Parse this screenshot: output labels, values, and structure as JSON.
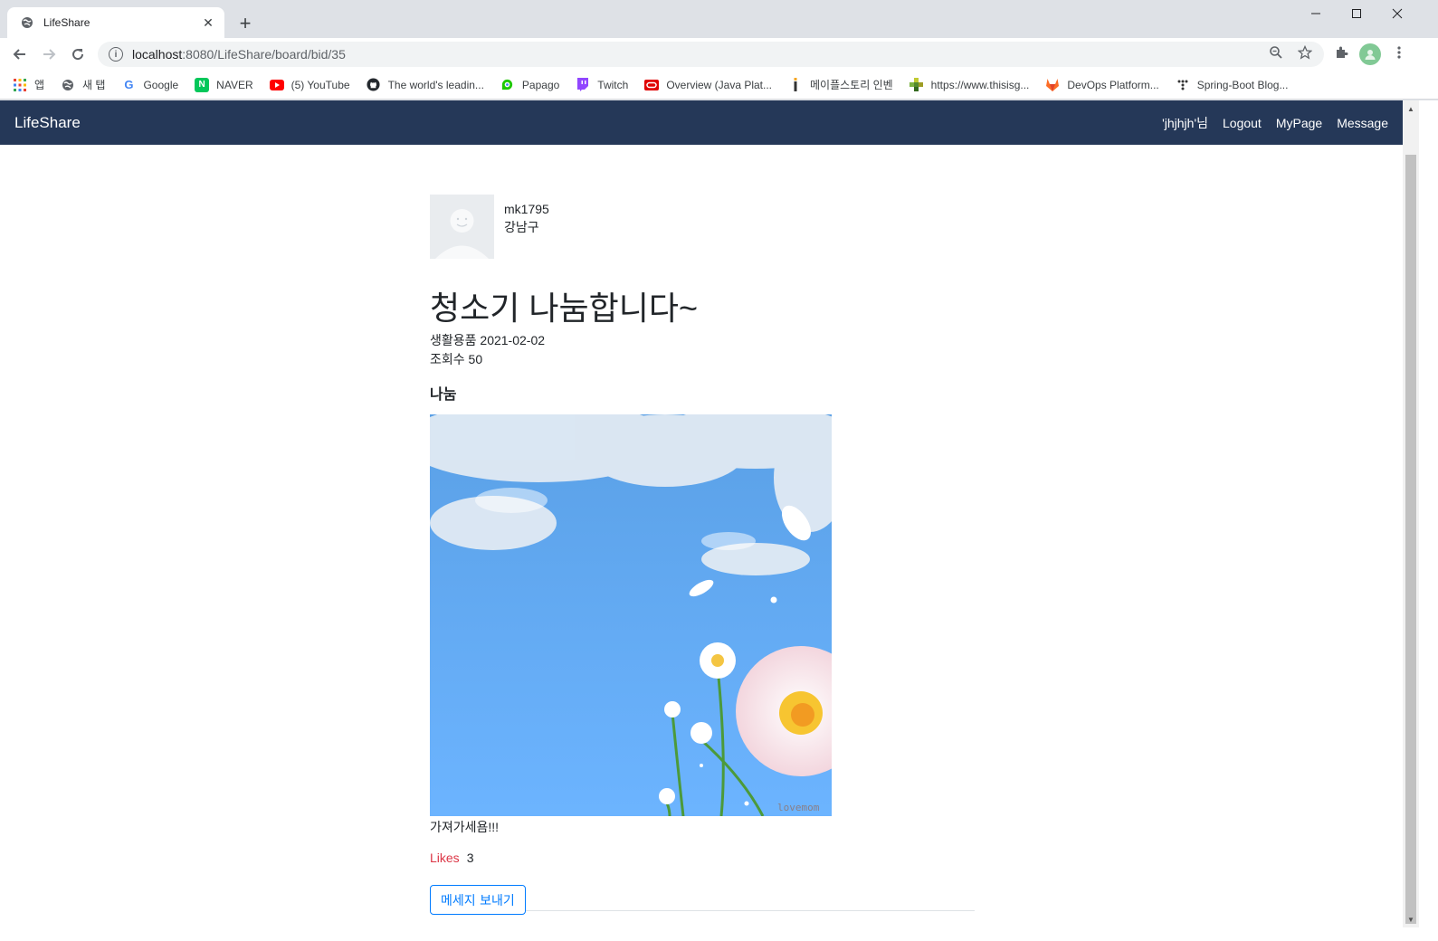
{
  "browser": {
    "tab_title": "LifeShare",
    "new_tab": "+",
    "url_host": "localhost",
    "url_path": ":8080/LifeShare/board/bid/35",
    "bookmarks": [
      {
        "label": "앱",
        "icon": "apps-grid-icon"
      },
      {
        "label": "새 탭",
        "icon": "globe-icon"
      },
      {
        "label": "Google",
        "icon": "google-icon"
      },
      {
        "label": "NAVER",
        "icon": "naver-icon"
      },
      {
        "label": "(5) YouTube",
        "icon": "youtube-icon"
      },
      {
        "label": "The world's leadin...",
        "icon": "github-icon"
      },
      {
        "label": "Papago",
        "icon": "papago-icon"
      },
      {
        "label": "Twitch",
        "icon": "twitch-icon"
      },
      {
        "label": "Overview (Java Plat...",
        "icon": "oracle-icon"
      },
      {
        "label": "메이플스토리 인벤",
        "icon": "inven-icon"
      },
      {
        "label": "https://www.thisisg...",
        "icon": "thisisgame-icon"
      },
      {
        "label": "DevOps Platform...",
        "icon": "gitlab-icon"
      },
      {
        "label": "Spring-Boot Blog...",
        "icon": "blog-icon"
      }
    ]
  },
  "site": {
    "brand": "LifeShare",
    "nav": {
      "user": "'jhjhjh'님",
      "logout": "Logout",
      "mypage": "MyPage",
      "message": "Message"
    }
  },
  "post": {
    "author_id": "mk1795",
    "author_location": "강남구",
    "title": "청소기 나눔합니다~",
    "category_date": "생활용품 2021-02-02",
    "views": "조회수 50",
    "deal_type": "나눔",
    "image_watermark": "lovemom",
    "body": "가져가세욤!!!",
    "likes_label": "Likes",
    "likes_count": "3",
    "message_button": "메세지 보내기"
  },
  "colors": {
    "navbar": "#253858",
    "likes_label": "#dc3545",
    "button_outline": "#007bff"
  }
}
